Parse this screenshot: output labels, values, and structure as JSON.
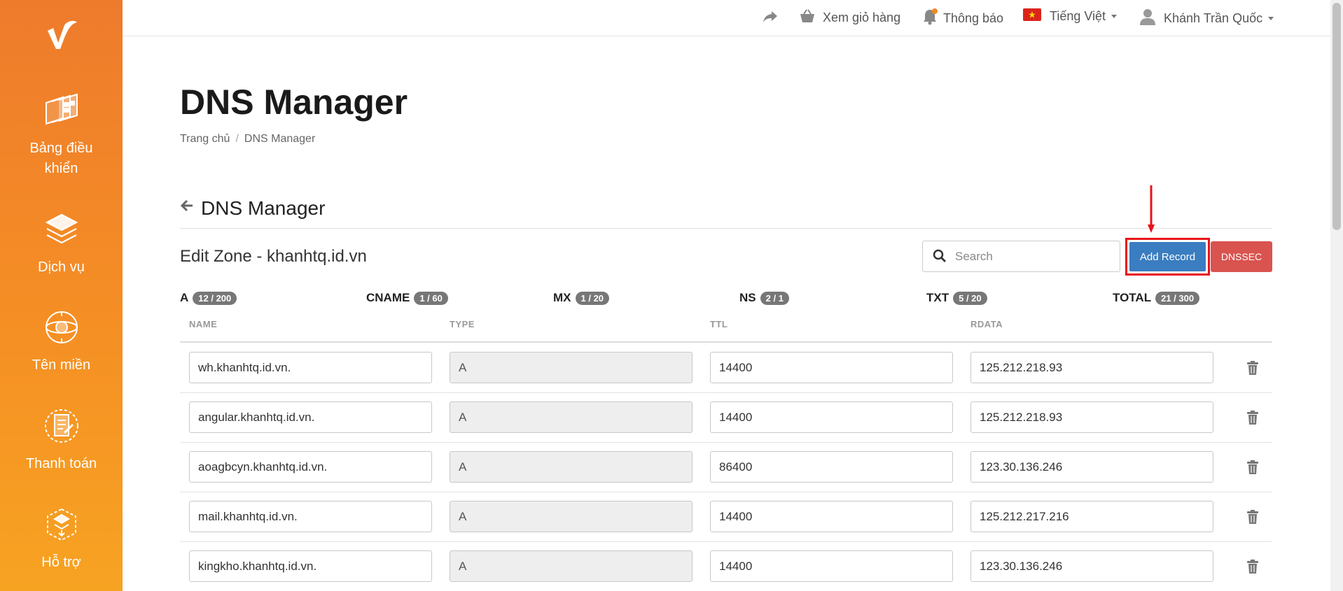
{
  "sidebar": {
    "items": [
      {
        "label": "Bảng điều khiển",
        "icon": "dashboard-icon"
      },
      {
        "label": "Dịch vụ",
        "icon": "layers-icon"
      },
      {
        "label": "Tên miền",
        "icon": "globe-icon"
      },
      {
        "label": "Thanh toán",
        "icon": "invoice-icon"
      },
      {
        "label": "Hỗ trợ",
        "icon": "support-icon"
      }
    ]
  },
  "topbar": {
    "cart_label": "Xem giỏ hàng",
    "notify_label": "Thông báo",
    "language_label": "Tiếng Việt",
    "user_label": "Khánh Trần Quốc"
  },
  "page": {
    "title": "DNS Manager",
    "breadcrumb": [
      "Trang chủ",
      "DNS Manager"
    ]
  },
  "section": {
    "title": "DNS Manager",
    "zone_title": "Edit Zone - khanhtq.id.vn"
  },
  "search": {
    "placeholder": "Search"
  },
  "buttons": {
    "add_record": "Add Record",
    "dnssec": "DNSSEC"
  },
  "counts": [
    {
      "label": "A",
      "badge": "12 / 200"
    },
    {
      "label": "CNAME",
      "badge": "1 / 60"
    },
    {
      "label": "MX",
      "badge": "1 / 20"
    },
    {
      "label": "NS",
      "badge": "2 / 1"
    },
    {
      "label": "TXT",
      "badge": "5 / 20"
    },
    {
      "label": "TOTAL",
      "badge": "21 / 300"
    }
  ],
  "table": {
    "headers": [
      "NAME",
      "TYPE",
      "TTL",
      "RDATA"
    ],
    "rows": [
      {
        "name": "wh.khanhtq.id.vn.",
        "type": "A",
        "ttl": "14400",
        "rdata": "125.212.218.93"
      },
      {
        "name": "angular.khanhtq.id.vn.",
        "type": "A",
        "ttl": "14400",
        "rdata": "125.212.218.93"
      },
      {
        "name": "aoagbcyn.khanhtq.id.vn.",
        "type": "A",
        "ttl": "86400",
        "rdata": "123.30.136.246"
      },
      {
        "name": "mail.khanhtq.id.vn.",
        "type": "A",
        "ttl": "14400",
        "rdata": "125.212.217.216"
      },
      {
        "name": "kingkho.khanhtq.id.vn.",
        "type": "A",
        "ttl": "14400",
        "rdata": "123.30.136.246"
      }
    ]
  },
  "colors": {
    "sidebar_top": "#ee7b2c",
    "sidebar_bottom": "#f7a322",
    "primary": "#3a7dc0",
    "danger": "#d9534f",
    "annotation": "#e8121a"
  }
}
